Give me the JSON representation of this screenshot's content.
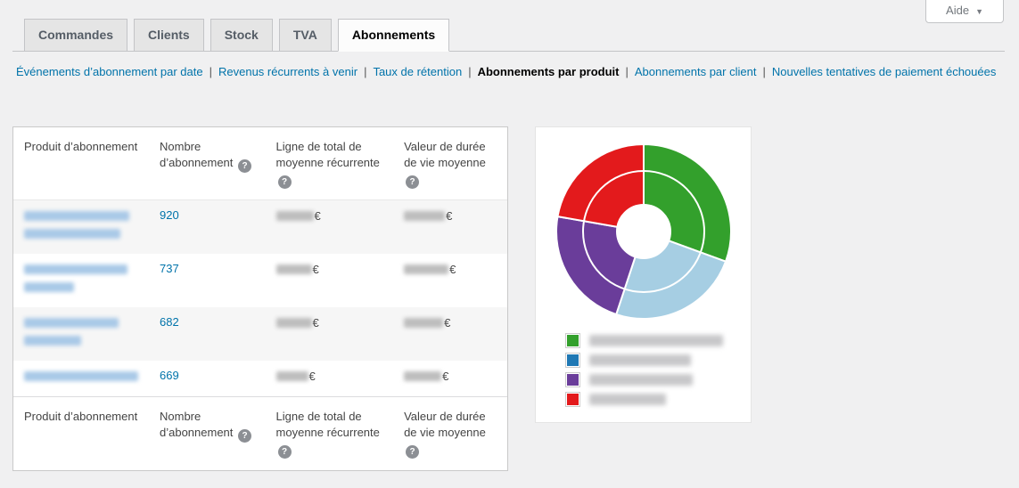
{
  "help_button": {
    "label": "Aide",
    "caret_icon": "▼"
  },
  "tabs": [
    {
      "label": "Commandes",
      "active": false
    },
    {
      "label": "Clients",
      "active": false
    },
    {
      "label": "Stock",
      "active": false
    },
    {
      "label": "TVA",
      "active": false
    },
    {
      "label": "Abonnements",
      "active": true
    }
  ],
  "subnav": {
    "separator": "|",
    "items": [
      {
        "label": "Événements d’abonnement par date",
        "active": false
      },
      {
        "label": "Revenus récurrents à venir",
        "active": false
      },
      {
        "label": "Taux de rétention",
        "active": false
      },
      {
        "label": "Abonnements par produit",
        "active": true
      },
      {
        "label": "Abonnements par client",
        "active": false
      },
      {
        "label": "Nouvelles tentatives de paiement échouées",
        "active": false
      }
    ]
  },
  "table": {
    "headers": [
      {
        "label": "Produit d’abonnement",
        "help": false
      },
      {
        "label": "Nombre d’abonnement",
        "help": true
      },
      {
        "label": "Ligne de total de moyenne récurrente",
        "help": true
      },
      {
        "label": "Valeur de durée de vie moyenne",
        "help": true
      }
    ],
    "help_icon_glyph": "?",
    "currency_symbol": "€",
    "rows": [
      {
        "subscription_count": "920",
        "product_name_redacted": true,
        "name_lines": 2,
        "avg_recurring_total_redacted": true,
        "avg_lifetime_value_redacted": true
      },
      {
        "subscription_count": "737",
        "product_name_redacted": true,
        "name_lines": 2,
        "avg_recurring_total_redacted": true,
        "avg_lifetime_value_redacted": true
      },
      {
        "subscription_count": "682",
        "product_name_redacted": true,
        "name_lines": 2,
        "avg_recurring_total_redacted": true,
        "avg_lifetime_value_redacted": true
      },
      {
        "subscription_count": "669",
        "product_name_redacted": true,
        "name_lines": 1,
        "avg_recurring_total_redacted": true,
        "avg_lifetime_value_redacted": true
      }
    ]
  },
  "chart_data": {
    "type": "pie",
    "style": "double-ring-donut",
    "series": [
      {
        "name": "Nombre d’abonnement",
        "values": [
          920,
          737,
          682,
          669
        ]
      }
    ],
    "categories_redacted": true,
    "segment_colors": [
      "#33a02c",
      "#a6cee3",
      "#6a3d9a",
      "#e31a1c"
    ],
    "start_angle_deg": 0,
    "direction": "clockwise",
    "legend": {
      "position": "bottom",
      "marker_colors": [
        "#33a02c",
        "#1f78b4",
        "#6a3d9a",
        "#e31a1c"
      ],
      "labels_redacted": true
    }
  },
  "colors": {
    "link": "#0073aa",
    "page_background": "#f0f0f1",
    "active_subnav_text": "#000000"
  }
}
